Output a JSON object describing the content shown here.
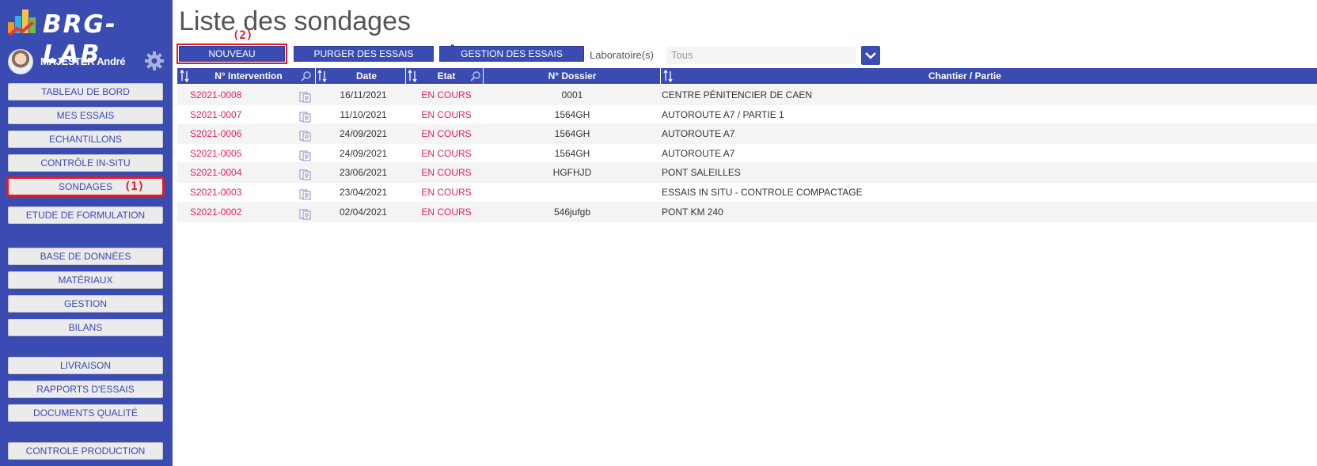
{
  "app": {
    "logo_text": "BRG-LAB",
    "user_name": "MAJESTER André"
  },
  "sidebar": {
    "items": [
      {
        "label": "TABLEAU DE BORD"
      },
      {
        "label": "MES ESSAIS"
      },
      {
        "label": "ECHANTILLONS"
      },
      {
        "label": "CONTRÔLE IN-SITU"
      },
      {
        "label": "SONDAGES",
        "active": true
      },
      {
        "label": "ETUDE DE FORMULATION"
      },
      {
        "label": "BASE DE DONNÉES"
      },
      {
        "label": "MATÉRIAUX"
      },
      {
        "label": "GESTION"
      },
      {
        "label": "BILANS"
      },
      {
        "label": "LIVRAISON"
      },
      {
        "label": "RAPPORTS D'ESSAIS"
      },
      {
        "label": "DOCUMENTS QUALITÉ"
      },
      {
        "label": "CONTROLE PRODUCTION"
      }
    ]
  },
  "annotations": {
    "step1": "(1)",
    "step2": "(2)"
  },
  "main": {
    "title": "Liste des sondages",
    "toolbar": {
      "nouveau": "NOUVEAU",
      "purger": "PURGER DES ESSAIS",
      "gestion": "GESTION DES ESSAIS",
      "lab_label": "Laboratoire(s)",
      "lab_value": "Tous"
    },
    "table": {
      "headers": {
        "intervention": "N° Intervention",
        "date": "Date",
        "etat": "Etat",
        "dossier": "N° Dossier",
        "chantier": "Chantier / Partie"
      },
      "rows": [
        {
          "id": "S2021-0008",
          "date": "16/11/2021",
          "etat": "EN COURS",
          "dossier": "0001",
          "chantier": "CENTRE PÉNITENCIER DE CAEN"
        },
        {
          "id": "S2021-0007",
          "date": "11/10/2021",
          "etat": "EN COURS",
          "dossier": "1564GH",
          "chantier": "AUTOROUTE A7 / PARTIE 1"
        },
        {
          "id": "S2021-0006",
          "date": "24/09/2021",
          "etat": "EN COURS",
          "dossier": "1564GH",
          "chantier": "AUTOROUTE A7"
        },
        {
          "id": "S2021-0005",
          "date": "24/09/2021",
          "etat": "EN COURS",
          "dossier": "1564GH",
          "chantier": "AUTOROUTE A7"
        },
        {
          "id": "S2021-0004",
          "date": "23/06/2021",
          "etat": "EN COURS",
          "dossier": "HGFHJD",
          "chantier": "PONT SALEILLES"
        },
        {
          "id": "S2021-0003",
          "date": "23/04/2021",
          "etat": "EN COURS",
          "dossier": "",
          "chantier": "ESSAIS IN SITU - CONTROLE COMPACTAGE"
        },
        {
          "id": "S2021-0002",
          "date": "02/04/2021",
          "etat": "EN COURS",
          "dossier": "546jufgb",
          "chantier": "PONT KM 240"
        }
      ]
    }
  },
  "colors": {
    "brand": "#3a4bb2",
    "highlight": "#e01b2a",
    "link": "#e2225b"
  }
}
